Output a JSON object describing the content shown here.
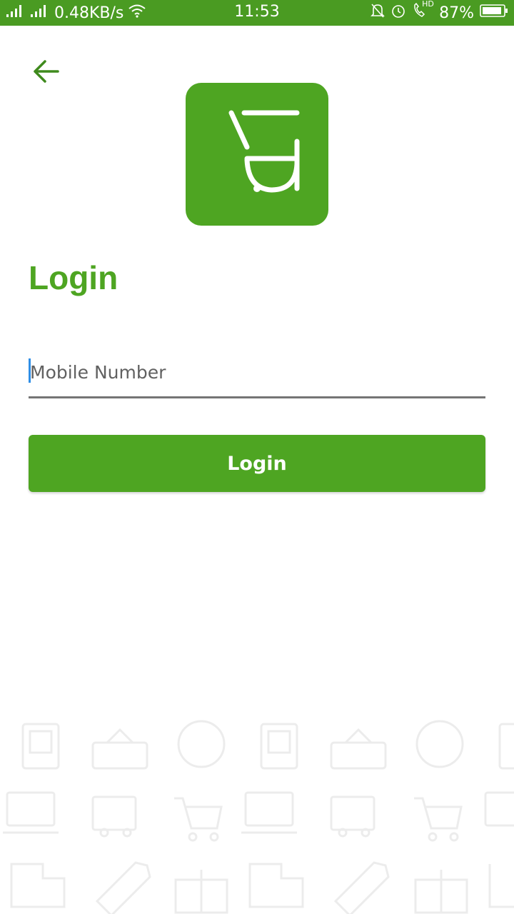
{
  "status_bar": {
    "network_speed": "0.48KB/s",
    "time": "11:53",
    "battery": "87%",
    "hd_label": "HD",
    "icons": [
      "signal-icon",
      "signal-icon",
      "wifi-icon",
      "mute-bell-icon",
      "alarm-icon",
      "call-icon",
      "battery-icon"
    ]
  },
  "header": {
    "back_icon": "arrow-left-icon"
  },
  "logo": {
    "icon": "cart-logo-icon"
  },
  "page": {
    "title": "Login"
  },
  "form": {
    "mobile_placeholder": "Mobile Number",
    "mobile_value": "",
    "submit_label": "Login"
  },
  "background": {
    "icons": [
      "shopping-bag-icon",
      "open-sign-icon",
      "24-hours-icon",
      "laptop-shop-icon",
      "gift-cart-icon",
      "shopping-cart-icon",
      "sale-tag-icon",
      "gift-box-icon"
    ]
  },
  "colors": {
    "brand_green": "#4ea522",
    "status_bar": "#4a9b22",
    "underline": "#757575",
    "cursor": "#2f8ee6"
  }
}
